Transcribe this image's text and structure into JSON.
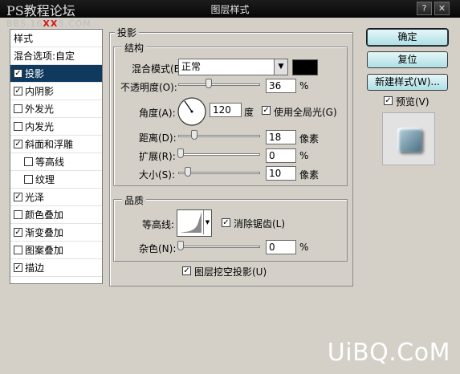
{
  "window": {
    "title": "图层样式",
    "watermark": "PS教程论坛",
    "watermark_sub": {
      "a": "BBS.16",
      "b": "XX",
      "c": "8.COM"
    },
    "help_icon": "question-mark-icon",
    "close_icon": "close-icon"
  },
  "style_list": {
    "header": "样式",
    "blend": "混合选项:自定",
    "items": [
      {
        "label": "投影",
        "checked": true
      },
      {
        "label": "内阴影",
        "checked": true
      },
      {
        "label": "外发光",
        "checked": false
      },
      {
        "label": "内发光",
        "checked": false
      },
      {
        "label": "斜面和浮雕",
        "checked": true
      },
      {
        "label": "等高线",
        "checked": false
      },
      {
        "label": "纹理",
        "checked": false
      },
      {
        "label": "光泽",
        "checked": true
      },
      {
        "label": "颜色叠加",
        "checked": false
      },
      {
        "label": "渐变叠加",
        "checked": true
      },
      {
        "label": "图案叠加",
        "checked": false
      },
      {
        "label": "描边",
        "checked": true
      }
    ]
  },
  "panel": {
    "title": "投影",
    "structure": {
      "label": "结构",
      "blend_mode_label": "混合模式(B):",
      "blend_mode_value": "正常",
      "shadow_color": "#000000",
      "opacity_label": "不透明度(O):",
      "opacity_value": "36",
      "opacity_unit": "%",
      "angle_label": "角度(A):",
      "angle_value": "120",
      "angle_unit": "度",
      "global_light_label": "使用全局光(G)",
      "global_light_checked": true,
      "distance_label": "距离(D):",
      "distance_value": "18",
      "distance_unit": "像素",
      "spread_label": "扩展(R):",
      "spread_value": "0",
      "spread_unit": "%",
      "size_label": "大小(S):",
      "size_value": "10",
      "size_unit": "像素"
    },
    "quality": {
      "label": "品质",
      "contour_label": "等高线:",
      "antialias_label": "消除锯齿(L)",
      "antialias_checked": true,
      "noise_label": "杂色(N):",
      "noise_value": "0",
      "noise_unit": "%"
    },
    "knockout_label": "图层挖空投影(U)",
    "knockout_checked": true
  },
  "buttons": {
    "ok": "确定",
    "reset": "复位",
    "new_style": "新建样式(W)...",
    "preview_label": "预览(V)",
    "preview_checked": true
  },
  "footer": {
    "brand": "UiBQ.CoM"
  }
}
